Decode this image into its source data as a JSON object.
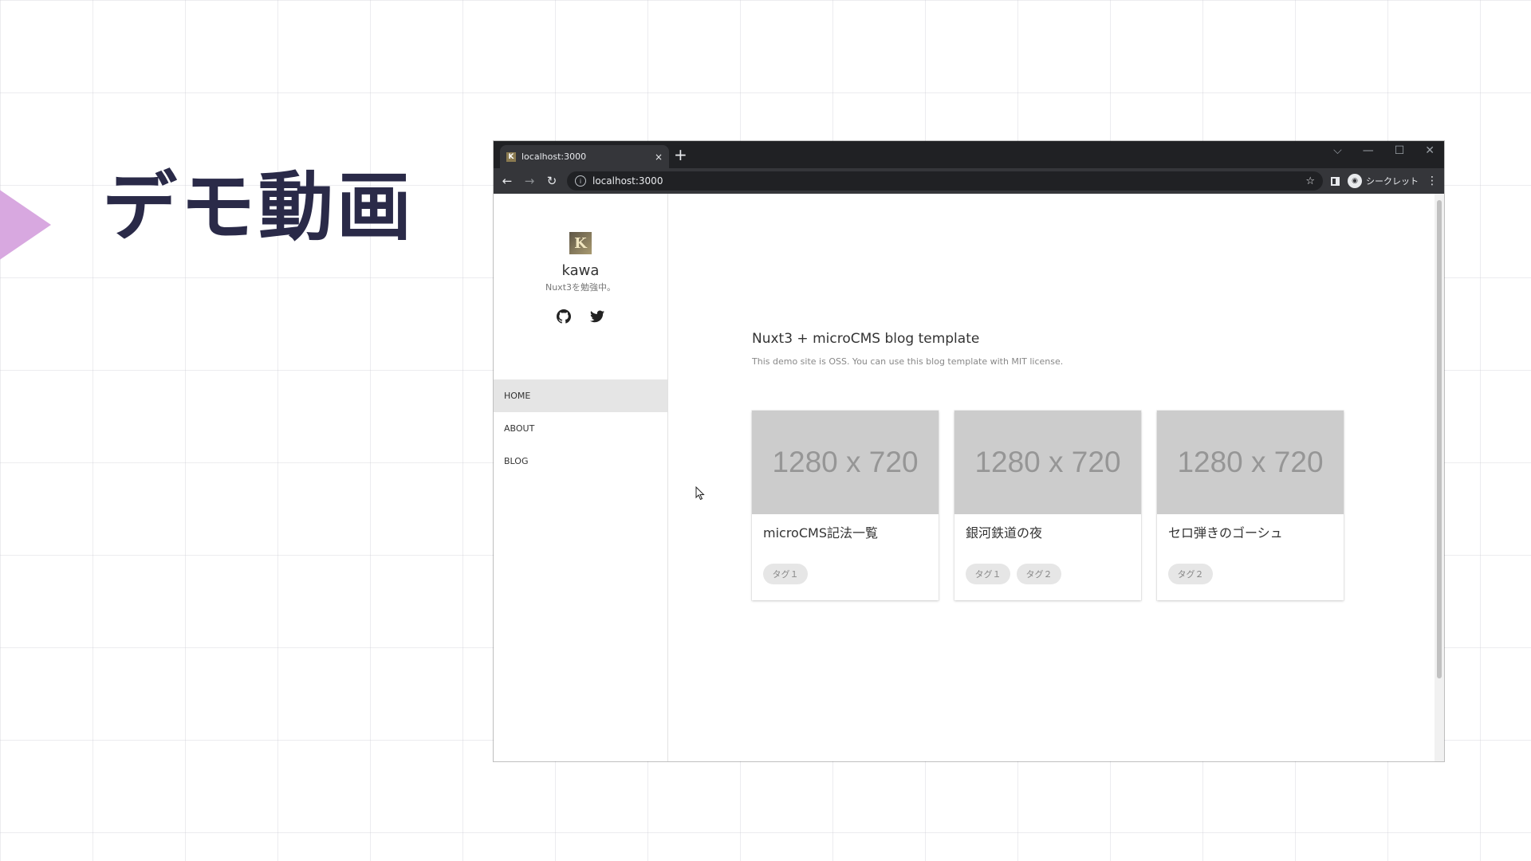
{
  "slide": {
    "title": "デモ動画"
  },
  "browser": {
    "tab_title": "localhost:3000",
    "tab_close": "×",
    "new_tab": "+",
    "win_min": "—",
    "win_max": "☐",
    "win_close": "✕",
    "win_chevron": "⌵",
    "back": "←",
    "forward": "→",
    "reload": "↻",
    "url": "localhost:3000",
    "star": "☆",
    "incognito_label": "シークレット",
    "menu": "⋮"
  },
  "site": {
    "avatar_letter": "K",
    "name": "kawa",
    "description": "Nuxt3を勉強中。",
    "nav": [
      {
        "label": "HOME"
      },
      {
        "label": "ABOUT"
      },
      {
        "label": "BLOG"
      }
    ]
  },
  "main": {
    "title": "Nuxt3 + microCMS blog template",
    "description": "This demo site is OSS. You can use this blog template with MIT license.",
    "cards": [
      {
        "image_text": "1280 x 720",
        "title": "microCMS記法一覧",
        "tags": [
          "タグ１"
        ]
      },
      {
        "image_text": "1280 x 720",
        "title": "銀河鉄道の夜",
        "tags": [
          "タグ１",
          "タグ２"
        ]
      },
      {
        "image_text": "1280 x 720",
        "title": "セロ弾きのゴーシュ",
        "tags": [
          "タグ２"
        ]
      }
    ]
  },
  "colors": {
    "slide_title": "#2a2a48",
    "slide_arrow": "#d8a8e0",
    "browser_frame": "#202124",
    "placeholder": "#cccccc"
  }
}
